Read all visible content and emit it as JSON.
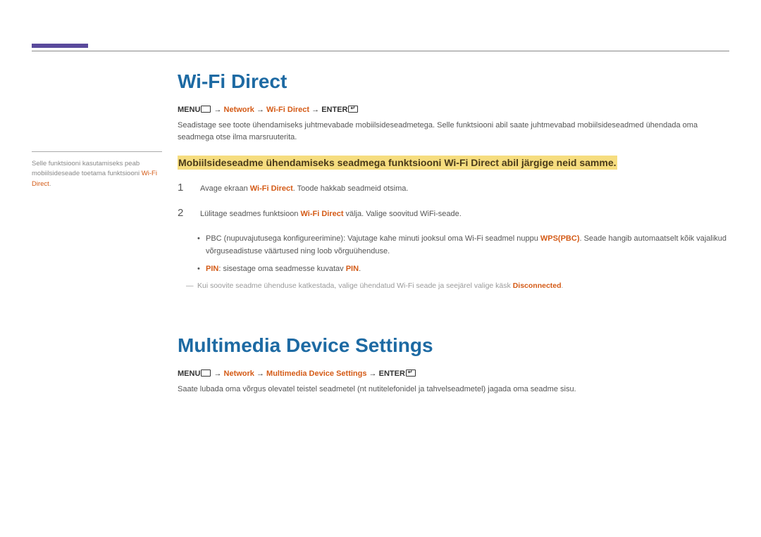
{
  "sidebar": {
    "note_prefix": "Selle funktsiooni kasutamiseks peab mobiilsideseade toetama funktsiooni ",
    "note_term": "Wi-Fi Direct",
    "note_suffix": "."
  },
  "section1": {
    "heading": "Wi-Fi Direct",
    "path": {
      "menu": "MENU",
      "seg1": "Network",
      "seg2": "Wi-Fi Direct",
      "enter": "ENTER"
    },
    "intro": "Seadistage see toote ühendamiseks juhtmevabade mobiilsideseadmetega. Selle funktsiooni abil saate juhtmevabad mobiilsideseadmed ühendada oma seadmega otse ilma marsruuterita.",
    "highlight": "Mobiilsideseadme ühendamiseks seadmega funktsiooni Wi-Fi Direct abil järgige neid samme.",
    "step1": {
      "num": "1",
      "pre": "Avage ekraan ",
      "hl": "Wi-Fi Direct",
      "post": ". Toode hakkab seadmeid otsima."
    },
    "step2": {
      "num": "2",
      "pre": "Lülitage seadmes funktsioon ",
      "hl": "Wi-Fi Direct",
      "post": " välja. Valige soovitud WiFi-seade."
    },
    "bullet1": {
      "pre": "PBC (nupuvajutusega konfigureerimine): Vajutage kahe minuti jooksul oma Wi-Fi seadmel nuppu ",
      "hl": "WPS(PBC)",
      "post": ". Seade hangib automaatselt kõik vajalikud võrguseadistuse väärtused ning loob võrguühenduse."
    },
    "bullet2": {
      "hl1": "PIN",
      "mid": ": sisestage oma seadmesse kuvatav ",
      "hl2": "PIN",
      "post": "."
    },
    "dashnote": {
      "pre": "Kui soovite seadme ühenduse katkestada, valige ühendatud Wi-Fi seade ja seejärel valige käsk ",
      "hl": "Disconnected",
      "post": "."
    }
  },
  "section2": {
    "heading": "Multimedia Device Settings",
    "path": {
      "menu": "MENU",
      "seg1": "Network",
      "seg2": "Multimedia Device Settings",
      "enter": "ENTER"
    },
    "intro": "Saate lubada oma võrgus olevatel teistel seadmetel (nt nutitelefonidel ja tahvelseadmetel) jagada oma seadme sisu."
  }
}
